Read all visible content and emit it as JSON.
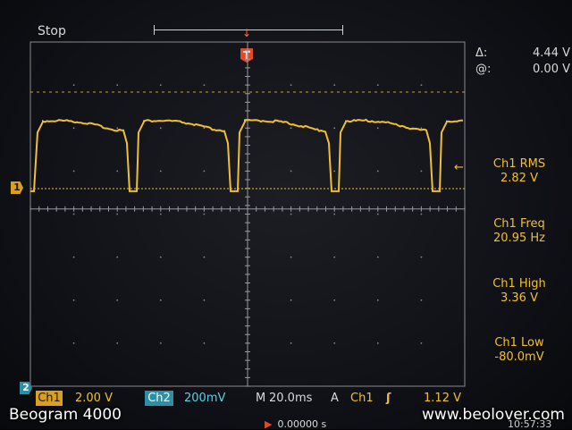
{
  "scope": {
    "run_state": "Stop",
    "trigger_position_symbol": "↓",
    "trigger_marker_label": "T",
    "ch1_ground_label": "1",
    "ch2_ground_label": "2",
    "trigger_level_symbol": "←"
  },
  "cursor_readout": {
    "delta_symbol": "Δ:",
    "delta_value": "4.44 V",
    "at_symbol": "@:",
    "at_value": "0.00 V"
  },
  "measurements": [
    {
      "label": "Ch1 RMS",
      "value": "2.82 V"
    },
    {
      "label": "Ch1 Freq",
      "value": "20.95 Hz"
    },
    {
      "label": "Ch1 High",
      "value": "3.36 V"
    },
    {
      "label": "Ch1 Low",
      "value": "-80.0mV"
    }
  ],
  "bottom_bar": {
    "ch1_label": "Ch1",
    "ch1_scale": "2.00 V",
    "ch2_label": "Ch2",
    "ch2_scale": "200mV",
    "m_label": "M",
    "timebase": "20.0ms",
    "a_label": "A",
    "trigger_source": "Ch1",
    "trigger_slope": "ʃ",
    "trigger_level": "1.12 V"
  },
  "partial_readouts": {
    "offset": "0.00000 s",
    "offset_arrow": "▶",
    "clock": "10:57:33"
  },
  "captions": {
    "left": "Beogram 4000",
    "right": "www.beolover.com"
  },
  "colors": {
    "ch1": "#f0c030",
    "ch2": "#2d8fa3",
    "trigger": "#e04a2a",
    "graticule": "#9a9a9a",
    "dashed_cursor": "#c9a02a"
  },
  "waveform": {
    "channel": "Ch1",
    "volts_per_div": 2.0,
    "seconds_per_div": 0.02,
    "frequency_hz": 20.95,
    "high_v": 3.36,
    "low_v": -0.08,
    "shape": "rectified-pulse"
  }
}
